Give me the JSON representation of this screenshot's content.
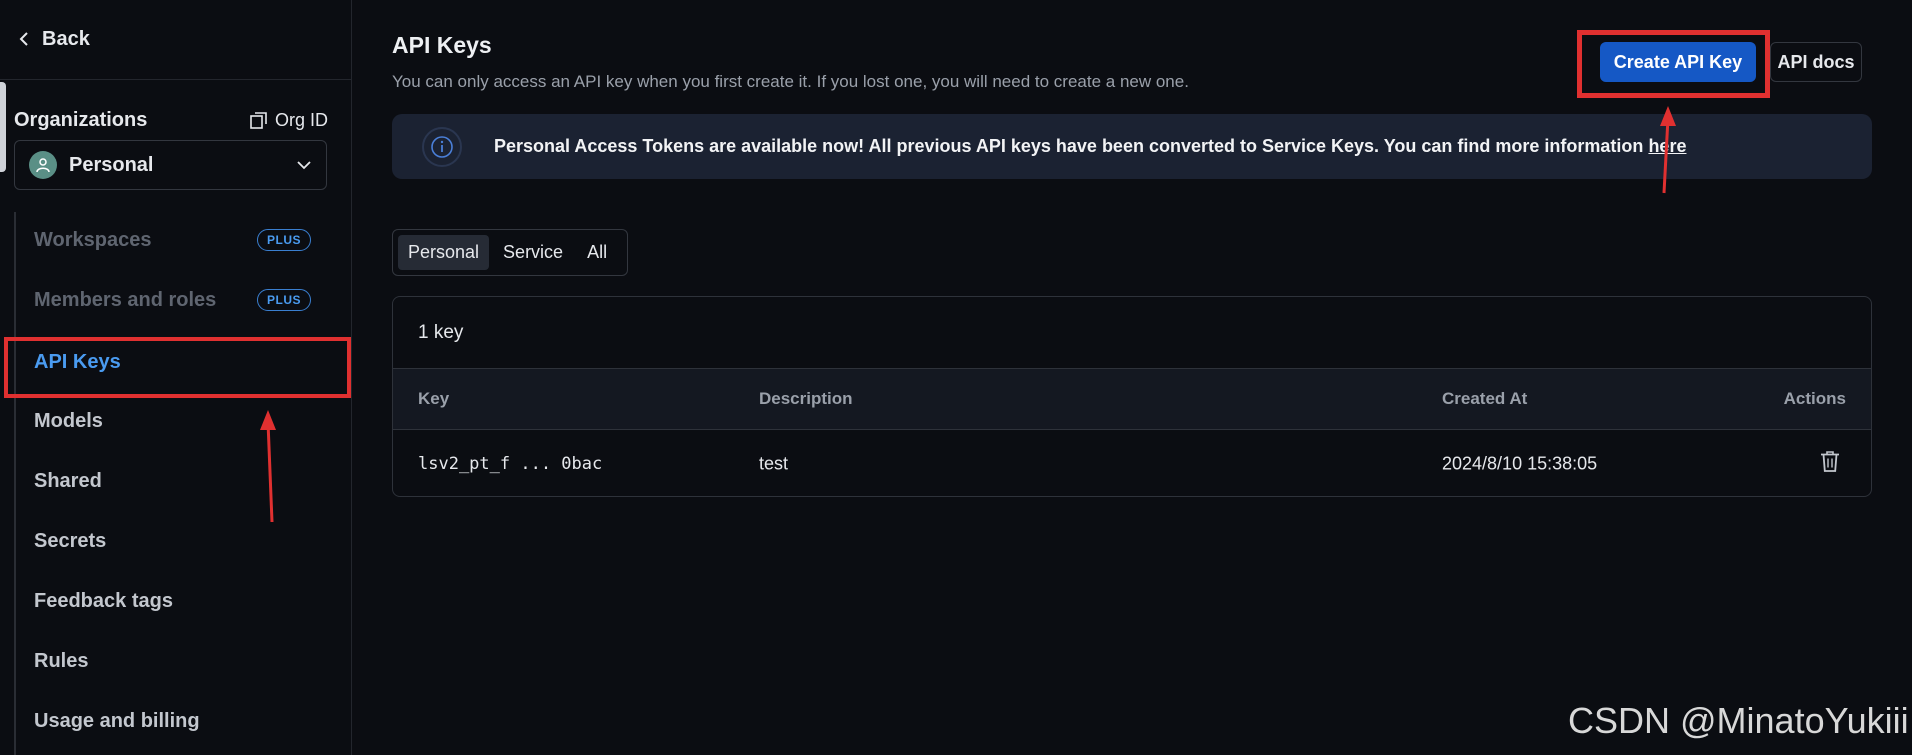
{
  "sidebar": {
    "back_label": "Back",
    "org_title": "Organizations",
    "org_id_label": "Org ID",
    "org_selected": "Personal",
    "plus_badge": "PLUS",
    "items": [
      {
        "label": "Workspaces"
      },
      {
        "label": "Members and roles"
      },
      {
        "label": "API Keys"
      },
      {
        "label": "Models"
      },
      {
        "label": "Shared"
      },
      {
        "label": "Secrets"
      },
      {
        "label": "Feedback tags"
      },
      {
        "label": "Rules"
      },
      {
        "label": "Usage and billing"
      }
    ]
  },
  "main": {
    "title": "API Keys",
    "subtitle": "You can only access an API key when you first create it. If you lost one, you will need to create a new one.",
    "create_button": "Create API Key",
    "docs_button": "API docs",
    "banner": {
      "text": "Personal Access Tokens are available now! All previous API keys have been converted to Service Keys. You can find more information",
      "link": "here"
    },
    "tabs": [
      {
        "label": "Personal",
        "active": true
      },
      {
        "label": "Service",
        "active": false
      },
      {
        "label": "All",
        "active": false
      }
    ],
    "table": {
      "count": "1 key",
      "columns": [
        "Key",
        "Description",
        "Created At",
        "Actions"
      ],
      "rows": [
        {
          "key": "lsv2_pt_f ... 0bac",
          "description": "test",
          "created_at": "2024/8/10 15:38:05"
        }
      ]
    }
  },
  "watermark": "CSDN @MinatoYukiii",
  "colors": {
    "accent": "#4a9bf0",
    "primary_button": "#1558c5",
    "annotation": "#e03030",
    "background": "#0b0d12"
  }
}
